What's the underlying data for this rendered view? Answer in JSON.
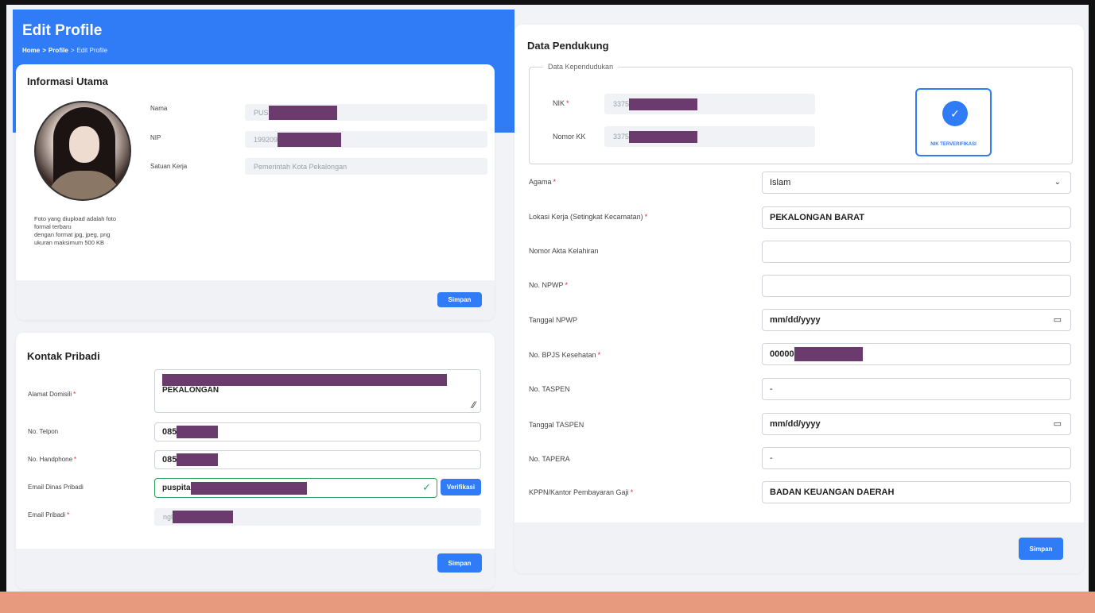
{
  "header": {
    "title": "Edit Profile",
    "breadcrumb": [
      "Home",
      ">",
      "Profile",
      ">",
      "Edit Profile"
    ]
  },
  "informasi_utama": {
    "title": "Informasi Utama",
    "fields": [
      {
        "label": "Nama",
        "value": "PUS"
      },
      {
        "label": "NIP",
        "value": "199209"
      },
      {
        "label": "Satuan Kerja",
        "value": "Pemerintah Kota Pekalongan"
      }
    ],
    "photo_note": [
      "Foto yang diupload adalah foto",
      "formal terbaru",
      "dengan format jpg, jpeg, png",
      "ukuran maksimum 500 KB"
    ],
    "save_label": "Simpan"
  },
  "kontak_pribadi": {
    "title": "Kontak Pribadi",
    "alamat_label": "Alamat Domisili",
    "alamat_value": "PEKALONGAN",
    "telpon_label": "No. Telpon",
    "telpon_value": "085",
    "hp_label": "No. Handphone",
    "hp_value": "085",
    "email_dinas_label": "Email Dinas Pribadi",
    "email_dinas_value": "puspita",
    "verifikasi_label": "Verifikasi",
    "email_pribadi_label": "Email Pribadi",
    "email_pribadi_value": "ngl",
    "save_label": "Simpan"
  },
  "data_pendukung": {
    "title": "Data Pendukung",
    "kependudukan_legend": "Data Kependudukan",
    "nik_label": "NIK",
    "nik_value": "3375",
    "kk_label": "Nomor KK",
    "kk_value": "3375",
    "verified_text": "NIK TERVERIFIKASI",
    "agama_label": "Agama",
    "agama_value": "Islam",
    "lokasi_label": "Lokasi Kerja (Setingkat Kecamatan)",
    "lokasi_value": "PEKALONGAN BARAT",
    "akta_label": "Nomor Akta Kelahiran",
    "akta_value": "",
    "npwp_label": "No. NPWP",
    "npwp_value": "",
    "tgl_npwp_label": "Tanggal NPWP",
    "tgl_npwp_value": "mm/dd/yyyy",
    "bpjs_label": "No. BPJS Kesehatan",
    "bpjs_value": "00000",
    "taspen_label": "No. TASPEN",
    "taspen_value": "-",
    "tgl_taspen_label": "Tanggal TASPEN",
    "tgl_taspen_value": "mm/dd/yyyy",
    "tapera_label": "No. TAPERA",
    "tapera_value": "-",
    "kppn_label": "KPPN/Kantor Pembayaran Gaji",
    "kppn_value": "BADAN KEUANGAN DAERAH",
    "save_label": "Simpan"
  },
  "colors": {
    "accent": "#2f7cf6",
    "required": "#e0243a",
    "redaction": "#6b3b6e",
    "bottom_bar": "#e89a7e"
  }
}
